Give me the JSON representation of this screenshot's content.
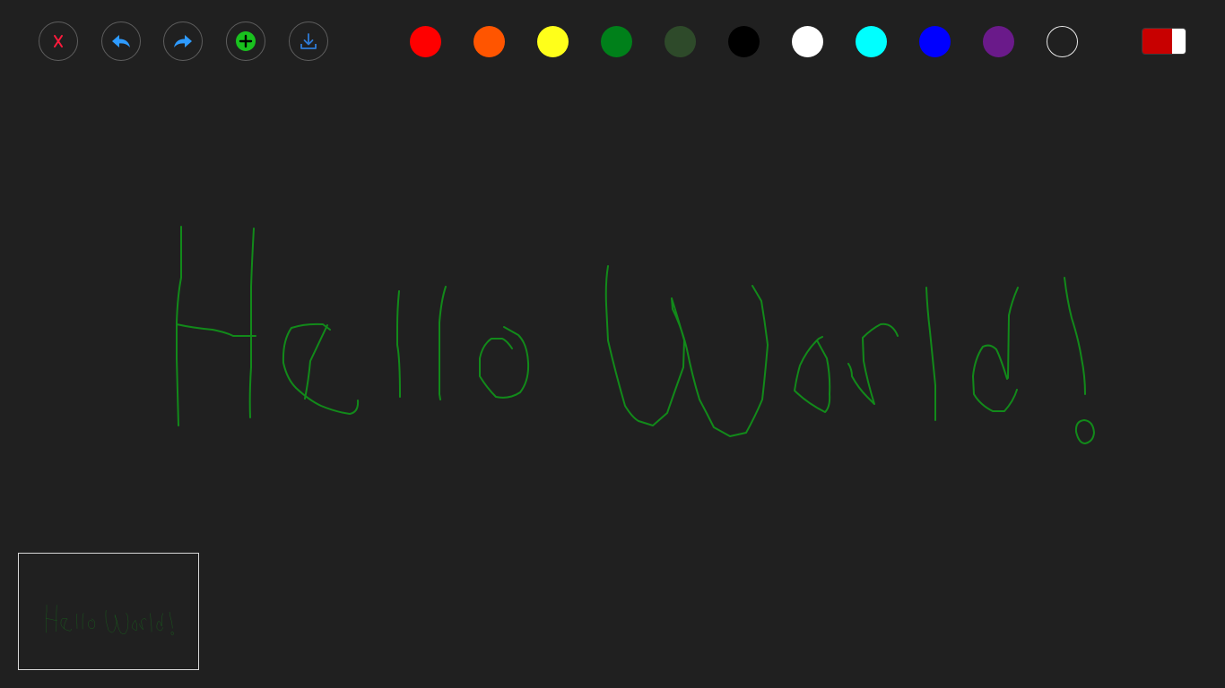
{
  "toolbar": {
    "buttons": [
      {
        "name": "clear-button",
        "icon": "x-icon",
        "color": "#ff1a3c"
      },
      {
        "name": "undo-button",
        "icon": "undo-arrow-icon",
        "color": "#2e9bff"
      },
      {
        "name": "redo-button",
        "icon": "redo-arrow-icon",
        "color": "#2e9bff"
      },
      {
        "name": "new-page-button",
        "icon": "plus-circle-icon",
        "color": "#19c11e"
      },
      {
        "name": "download-button",
        "icon": "download-icon",
        "color": "#2e7bd8"
      }
    ]
  },
  "palette": {
    "colors": [
      "#ff0000",
      "#ff5500",
      "#ffff1a",
      "#00801a",
      "#2e4a2a",
      "#000000",
      "#ffffff",
      "#00ffff",
      "#0000ff",
      "#6a1a8a",
      "transparent"
    ],
    "selected": "#00801a"
  },
  "mode_toggle": {
    "color": "#c80000",
    "on": true
  },
  "canvas": {
    "stroke_color": "#128a1a",
    "background": "#202020"
  },
  "thumbnail": {
    "stroke_color": "#128a1a"
  }
}
